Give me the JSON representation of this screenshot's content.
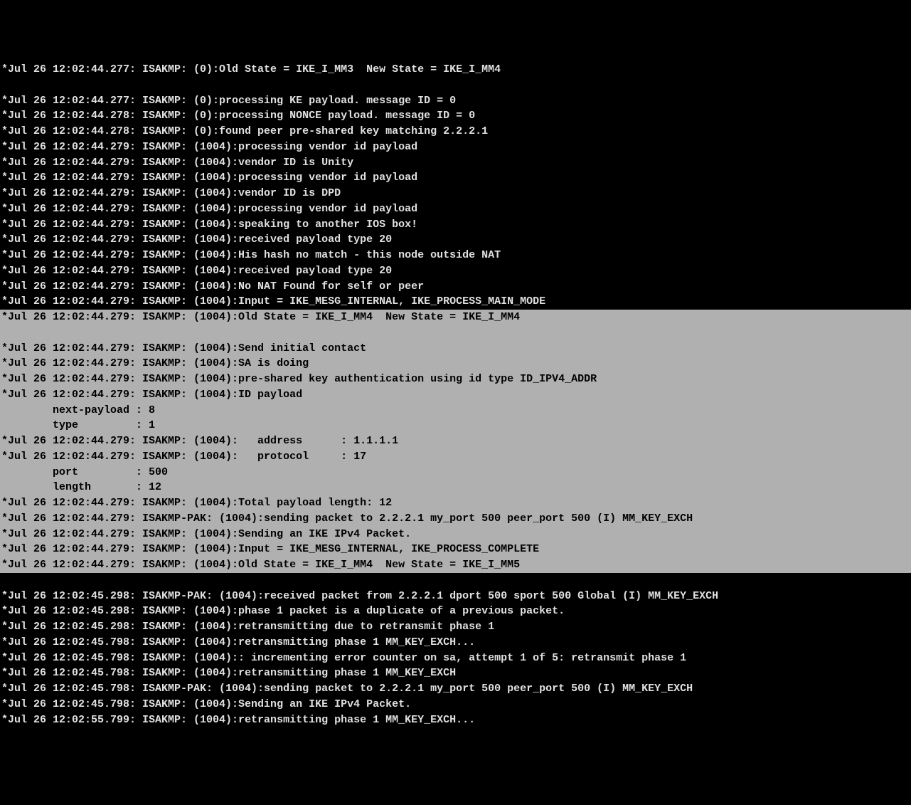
{
  "log": [
    {
      "hl": false,
      "blank": false,
      "text": "*Jul 26 12:02:44.277: ISAKMP: (0):Old State = IKE_I_MM3  New State = IKE_I_MM4"
    },
    {
      "hl": false,
      "blank": true,
      "text": ""
    },
    {
      "hl": false,
      "blank": false,
      "text": "*Jul 26 12:02:44.277: ISAKMP: (0):processing KE payload. message ID = 0"
    },
    {
      "hl": false,
      "blank": false,
      "text": "*Jul 26 12:02:44.278: ISAKMP: (0):processing NONCE payload. message ID = 0"
    },
    {
      "hl": false,
      "blank": false,
      "text": "*Jul 26 12:02:44.278: ISAKMP: (0):found peer pre-shared key matching 2.2.2.1"
    },
    {
      "hl": false,
      "blank": false,
      "text": "*Jul 26 12:02:44.279: ISAKMP: (1004):processing vendor id payload"
    },
    {
      "hl": false,
      "blank": false,
      "text": "*Jul 26 12:02:44.279: ISAKMP: (1004):vendor ID is Unity"
    },
    {
      "hl": false,
      "blank": false,
      "text": "*Jul 26 12:02:44.279: ISAKMP: (1004):processing vendor id payload"
    },
    {
      "hl": false,
      "blank": false,
      "text": "*Jul 26 12:02:44.279: ISAKMP: (1004):vendor ID is DPD"
    },
    {
      "hl": false,
      "blank": false,
      "text": "*Jul 26 12:02:44.279: ISAKMP: (1004):processing vendor id payload"
    },
    {
      "hl": false,
      "blank": false,
      "text": "*Jul 26 12:02:44.279: ISAKMP: (1004):speaking to another IOS box!"
    },
    {
      "hl": false,
      "blank": false,
      "text": "*Jul 26 12:02:44.279: ISAKMP: (1004):received payload type 20"
    },
    {
      "hl": false,
      "blank": false,
      "text": "*Jul 26 12:02:44.279: ISAKMP: (1004):His hash no match - this node outside NAT"
    },
    {
      "hl": false,
      "blank": false,
      "text": "*Jul 26 12:02:44.279: ISAKMP: (1004):received payload type 20"
    },
    {
      "hl": false,
      "blank": false,
      "text": "*Jul 26 12:02:44.279: ISAKMP: (1004):No NAT Found for self or peer"
    },
    {
      "hl": false,
      "blank": false,
      "text": "*Jul 26 12:02:44.279: ISAKMP: (1004):Input = IKE_MESG_INTERNAL, IKE_PROCESS_MAIN_MODE"
    },
    {
      "hl": true,
      "blank": false,
      "text": "*Jul 26 12:02:44.279: ISAKMP: (1004):Old State = IKE_I_MM4  New State = IKE_I_MM4"
    },
    {
      "hl": true,
      "blank": true,
      "text": ""
    },
    {
      "hl": true,
      "blank": false,
      "text": "*Jul 26 12:02:44.279: ISAKMP: (1004):Send initial contact"
    },
    {
      "hl": true,
      "blank": false,
      "text": "*Jul 26 12:02:44.279: ISAKMP: (1004):SA is doing"
    },
    {
      "hl": true,
      "blank": false,
      "text": "*Jul 26 12:02:44.279: ISAKMP: (1004):pre-shared key authentication using id type ID_IPV4_ADDR"
    },
    {
      "hl": true,
      "blank": false,
      "text": "*Jul 26 12:02:44.279: ISAKMP: (1004):ID payload"
    },
    {
      "hl": true,
      "blank": false,
      "text": "        next-payload : 8"
    },
    {
      "hl": true,
      "blank": false,
      "text": "        type         : 1"
    },
    {
      "hl": true,
      "blank": false,
      "text": "*Jul 26 12:02:44.279: ISAKMP: (1004):   address      : 1.1.1.1"
    },
    {
      "hl": true,
      "blank": false,
      "text": "*Jul 26 12:02:44.279: ISAKMP: (1004):   protocol     : 17"
    },
    {
      "hl": true,
      "blank": false,
      "text": "        port         : 500"
    },
    {
      "hl": true,
      "blank": false,
      "text": "        length       : 12"
    },
    {
      "hl": true,
      "blank": false,
      "text": "*Jul 26 12:02:44.279: ISAKMP: (1004):Total payload length: 12"
    },
    {
      "hl": true,
      "blank": false,
      "text": "*Jul 26 12:02:44.279: ISAKMP-PAK: (1004):sending packet to 2.2.2.1 my_port 500 peer_port 500 (I) MM_KEY_EXCH"
    },
    {
      "hl": true,
      "blank": false,
      "text": "*Jul 26 12:02:44.279: ISAKMP: (1004):Sending an IKE IPv4 Packet."
    },
    {
      "hl": true,
      "blank": false,
      "text": "*Jul 26 12:02:44.279: ISAKMP: (1004):Input = IKE_MESG_INTERNAL, IKE_PROCESS_COMPLETE"
    },
    {
      "hl": true,
      "blank": false,
      "text": "*Jul 26 12:02:44.279: ISAKMP: (1004):Old State = IKE_I_MM4  New State = IKE_I_MM5"
    },
    {
      "hl": false,
      "blank": true,
      "text": ""
    },
    {
      "hl": false,
      "blank": false,
      "text": "*Jul 26 12:02:45.298: ISAKMP-PAK: (1004):received packet from 2.2.2.1 dport 500 sport 500 Global (I) MM_KEY_EXCH"
    },
    {
      "hl": false,
      "blank": false,
      "text": "*Jul 26 12:02:45.298: ISAKMP: (1004):phase 1 packet is a duplicate of a previous packet."
    },
    {
      "hl": false,
      "blank": false,
      "text": "*Jul 26 12:02:45.298: ISAKMP: (1004):retransmitting due to retransmit phase 1"
    },
    {
      "hl": false,
      "blank": false,
      "text": "*Jul 26 12:02:45.798: ISAKMP: (1004):retransmitting phase 1 MM_KEY_EXCH..."
    },
    {
      "hl": false,
      "blank": false,
      "text": "*Jul 26 12:02:45.798: ISAKMP: (1004):: incrementing error counter on sa, attempt 1 of 5: retransmit phase 1"
    },
    {
      "hl": false,
      "blank": false,
      "text": "*Jul 26 12:02:45.798: ISAKMP: (1004):retransmitting phase 1 MM_KEY_EXCH"
    },
    {
      "hl": false,
      "blank": false,
      "text": "*Jul 26 12:02:45.798: ISAKMP-PAK: (1004):sending packet to 2.2.2.1 my_port 500 peer_port 500 (I) MM_KEY_EXCH"
    },
    {
      "hl": false,
      "blank": false,
      "text": "*Jul 26 12:02:45.798: ISAKMP: (1004):Sending an IKE IPv4 Packet."
    },
    {
      "hl": false,
      "blank": false,
      "text": "*Jul 26 12:02:55.799: ISAKMP: (1004):retransmitting phase 1 MM_KEY_EXCH..."
    }
  ]
}
